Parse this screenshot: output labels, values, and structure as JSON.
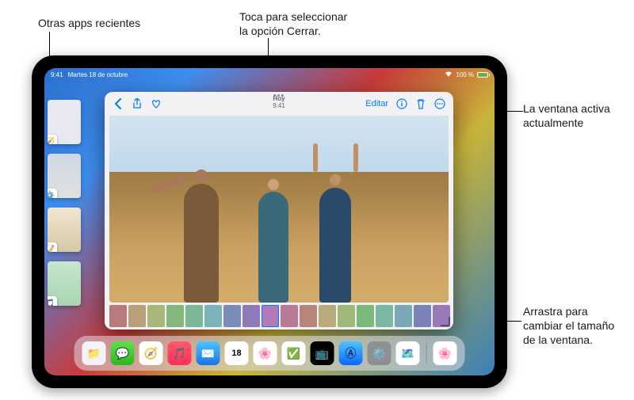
{
  "callouts": {
    "recent_apps": "Otras apps recientes",
    "tap_close": "Toca para seleccionar\nla opción Cerrar.",
    "active_window": "La ventana activa\nactualmente",
    "drag_resize": "Arrastra para\ncambiar el tamaño\nde la ventana."
  },
  "status": {
    "time": "9:41",
    "date": "Martes 18 de octubre",
    "battery_pct": "100 %",
    "wifi_glyph": "▲"
  },
  "active_window": {
    "title_line1": "Hoy",
    "title_line2": "9:41",
    "ellipsis": "•••",
    "editar": "Editar",
    "icons": {
      "back": "chevron-left-icon",
      "share": "share-icon",
      "heart": "heart-icon",
      "info": "info-icon",
      "trash": "trash-icon",
      "more": "ellipsis-circle-icon"
    }
  },
  "recent_apps": {
    "items": [
      {
        "icon_name": "safari-icon",
        "glyph": "🧭"
      },
      {
        "icon_name": "settings-icon",
        "glyph": "⚙️"
      },
      {
        "icon_name": "notes-icon",
        "glyph": "📝"
      },
      {
        "icon_name": "music-icon",
        "glyph": "🎵"
      }
    ]
  },
  "dock": {
    "items": [
      {
        "name": "files-icon",
        "bg": "#f2f2f7",
        "glyph": "📁"
      },
      {
        "name": "messages-icon",
        "bg": "linear-gradient(#5ee04f,#2bb81e)",
        "glyph": "💬"
      },
      {
        "name": "safari-icon",
        "bg": "#fff",
        "glyph": "🧭"
      },
      {
        "name": "music-icon",
        "bg": "linear-gradient(#ff5a6e,#ff2d55)",
        "glyph": "🎵"
      },
      {
        "name": "mail-icon",
        "bg": "linear-gradient(#4fc3ff,#1a73e8)",
        "glyph": "✉️"
      },
      {
        "name": "calendar-icon",
        "bg": "#fff",
        "glyph": "18"
      },
      {
        "name": "photos-icon",
        "bg": "#fff",
        "glyph": "🌸"
      },
      {
        "name": "reminders-icon",
        "bg": "#fff",
        "glyph": "✅"
      },
      {
        "name": "tv-icon",
        "bg": "#000",
        "glyph": "📺"
      },
      {
        "name": "appstore-icon",
        "bg": "linear-gradient(#4fc3ff,#0a66ff)",
        "glyph": "Ⓐ"
      },
      {
        "name": "settings-icon",
        "bg": "#8e8e93",
        "glyph": "⚙️"
      },
      {
        "name": "maps-icon",
        "bg": "#fff",
        "glyph": "🗺️"
      }
    ],
    "recent": [
      {
        "name": "photos-recent-icon",
        "bg": "#fff",
        "glyph": "🌸"
      }
    ]
  },
  "film_thumb_count": 18,
  "colors": {
    "accent": "#007aff"
  }
}
